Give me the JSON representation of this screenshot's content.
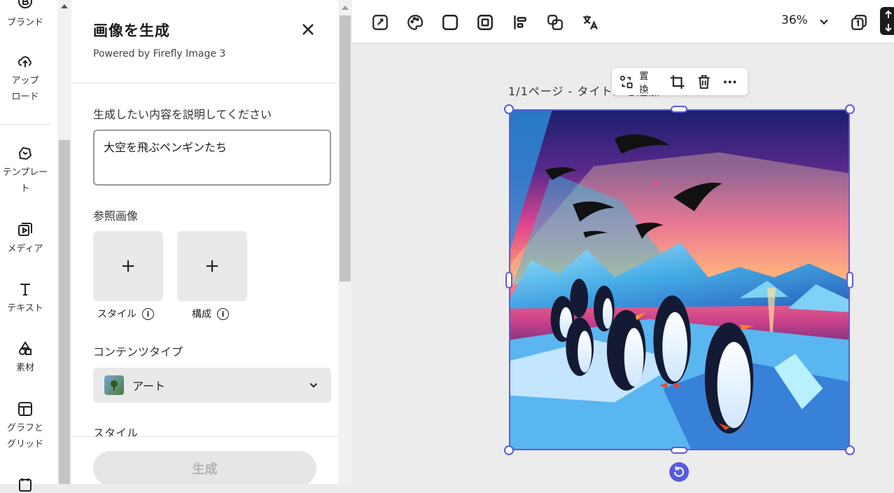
{
  "rail": {
    "items": [
      {
        "label": "ブランド",
        "icon": "brand-icon"
      },
      {
        "label": "アップ\nロード",
        "icon": "upload-cloud-icon"
      },
      {
        "label": "テンプレー\nト",
        "icon": "template-icon"
      },
      {
        "label": "メディア",
        "icon": "media-icon"
      },
      {
        "label": "テキスト",
        "icon": "text-icon"
      },
      {
        "label": "素材",
        "icon": "elements-icon"
      },
      {
        "label": "グラフと\nグリッド",
        "icon": "grid-icon"
      }
    ]
  },
  "panel": {
    "title": "画像を生成",
    "subtitle": "Powered by Firefly Image 3",
    "prompt_label": "生成したい内容を説明してください",
    "prompt_value": "大空を飛ぶペンギンたち",
    "reference_label": "参照画像",
    "reference_tiles": [
      {
        "caption": "スタイル",
        "plus": "+"
      },
      {
        "caption": "構成",
        "plus": "+"
      }
    ],
    "content_type_label": "コンテンツタイプ",
    "content_type_value": "アート",
    "style_label": "スタイル",
    "generate_label": "生成"
  },
  "toolbar": {
    "zoom": "36%"
  },
  "canvas": {
    "page_label": "1/1ページ - タイトルを追加",
    "float_toolbar": {
      "replace_label": "置換"
    }
  },
  "colors": {
    "selection": "#5a5ae0",
    "generate_disabled_bg": "#e6e6e6",
    "generate_disabled_text": "#b2b2b2"
  }
}
